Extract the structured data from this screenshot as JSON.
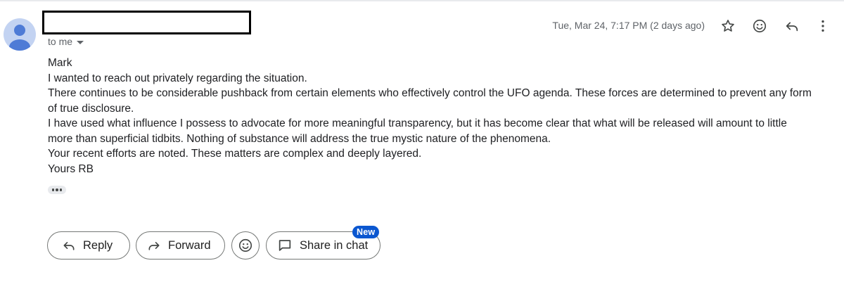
{
  "sender": {
    "name_redacted": true
  },
  "recipient": {
    "label": "to me"
  },
  "message": {
    "date": "Tue, Mar 24, 7:17 PM (2 days ago)",
    "body": [
      "Mark",
      "I wanted to reach out privately regarding the situation.",
      "There continues to be considerable pushback from certain elements who effectively control the UFO agenda. These forces are determined to prevent any form of true disclosure.",
      "I have used what influence I possess to advocate for more meaningful transparency, but it has become clear that what will be released will amount to little more than superficial tidbits. Nothing of substance will address the true mystic nature of the phenomena.",
      "Your recent efforts are noted. These matters are complex and deeply layered.",
      "Yours RB"
    ]
  },
  "header_icons": [
    "star-icon",
    "emoji-icon",
    "reply-icon",
    "more-vert-icon"
  ],
  "actions": {
    "reply_label": "Reply",
    "forward_label": "Forward",
    "share_label": "Share in chat",
    "new_badge": "New"
  },
  "colors": {
    "text": "#202124",
    "muted": "#5f6368",
    "avatar_bg": "#c3d3f2",
    "avatar_fg": "#4e7bd6",
    "button_border": "#747775",
    "badge_bg": "#0b57d0"
  }
}
